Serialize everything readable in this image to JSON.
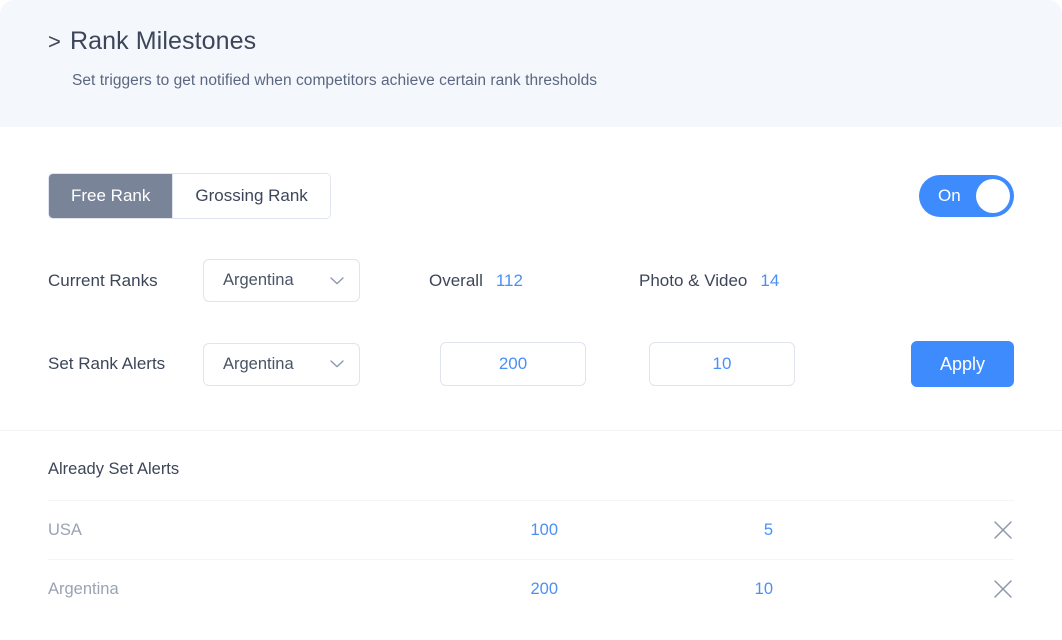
{
  "header": {
    "caret": ">",
    "title": "Rank Milestones",
    "subtitle": "Set triggers to get notified when competitors achieve certain rank thresholds"
  },
  "tabs": [
    {
      "label": "Free Rank",
      "active": true
    },
    {
      "label": "Grossing Rank",
      "active": false
    }
  ],
  "toggle": {
    "label": "On",
    "state": "on"
  },
  "current_ranks": {
    "label": "Current Ranks",
    "country": "Argentina",
    "overall_label": "Overall",
    "overall_value": "112",
    "photo_label": "Photo & Video",
    "photo_value": "14"
  },
  "set_alerts": {
    "label": "Set Rank Alerts",
    "country": "Argentina",
    "overall_value": "200",
    "overall_placeholder": "200",
    "photo_value": "10",
    "photo_placeholder": "10",
    "apply_label": "Apply"
  },
  "already_set": {
    "title": "Already Set Alerts",
    "rows": [
      {
        "country": "USA",
        "overall": "100",
        "photo": "5"
      },
      {
        "country": "Argentina",
        "overall": "200",
        "photo": "10"
      }
    ]
  },
  "colors": {
    "accent_blue": "#3d8bfd",
    "value_blue": "#4a90f7",
    "tab_active_bg": "#7a8499",
    "header_bg": "#f4f7fc",
    "text_dark": "#3d4659",
    "text_muted": "#9aa3b4"
  }
}
